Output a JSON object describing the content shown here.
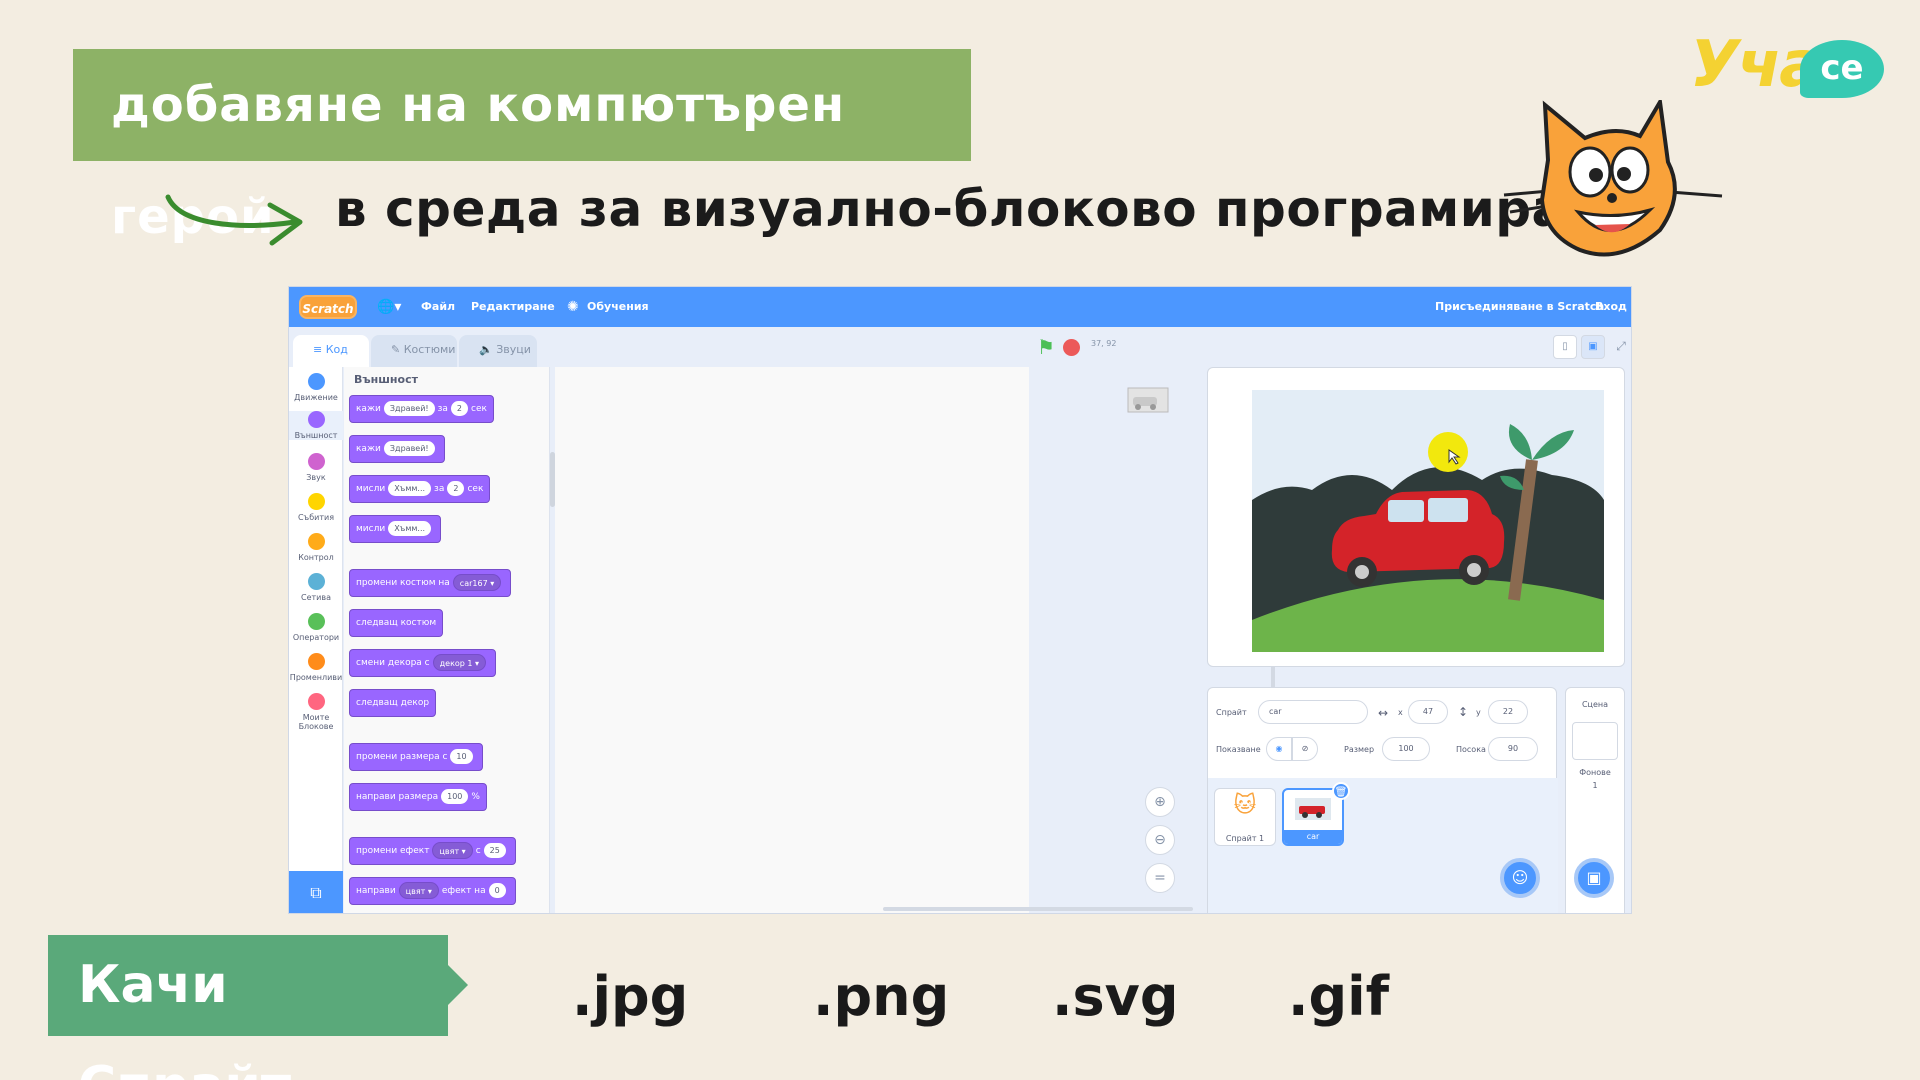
{
  "slide": {
    "title": "добавяне на компютърен герой",
    "subtitle": "в среда за визуално-блоково програмиране",
    "logo_text": "Уча",
    "logo_badge": "се",
    "upload_label": "Качи Спрайт",
    "extensions": [
      ".jpg",
      ".png",
      ".svg",
      ".gif"
    ]
  },
  "scratch": {
    "logo": "Scratch",
    "menu": {
      "file": "Файл",
      "edit": "Редактиране",
      "tutorials": "Обучения",
      "join": "Присъединяване в Scratch",
      "signin": "Вход"
    },
    "tabs": [
      "Код",
      "Костюми",
      "Звуци"
    ],
    "categories": [
      {
        "label": "Движение",
        "color": "#4c97ff"
      },
      {
        "label": "Външност",
        "color": "#9966ff"
      },
      {
        "label": "Звук",
        "color": "#cf63cf"
      },
      {
        "label": "Събития",
        "color": "#ffd500"
      },
      {
        "label": "Контрол",
        "color": "#ffab19"
      },
      {
        "label": "Сетива",
        "color": "#5cb1d6"
      },
      {
        "label": "Оператори",
        "color": "#59c059"
      },
      {
        "label": "Променливи",
        "color": "#ff8c1a"
      },
      {
        "label": "Моите Блокове",
        "color": "#ff6680"
      }
    ],
    "palette_title": "Външност",
    "blocks": {
      "say_for": {
        "verb": "кажи",
        "text": "Здравей!",
        "for": "за",
        "secs": "2",
        "unit": "сек"
      },
      "say": {
        "verb": "кажи",
        "text": "Здравей!"
      },
      "think_for": {
        "verb": "мисли",
        "text": "Хъмм...",
        "for": "за",
        "secs": "2",
        "unit": "сек"
      },
      "think": {
        "verb": "мисли",
        "text": "Хъмм..."
      },
      "switch_costume": {
        "text": "промени костюм на",
        "value": "car167 ▾"
      },
      "next_costume": {
        "text": "следващ костюм"
      },
      "switch_backdrop": {
        "text": "смени декора с",
        "value": "декор 1 ▾"
      },
      "next_backdrop": {
        "text": "следващ декор"
      },
      "change_size": {
        "text": "промени размера с",
        "value": "10"
      },
      "set_size": {
        "text": "направи размера",
        "value": "100",
        "unit": "%"
      },
      "change_effect": {
        "text": "промени ефект",
        "effect": "цвят ▾",
        "by": "с",
        "value": "25"
      },
      "set_effect": {
        "text": "направи",
        "effect": "цвят ▾",
        "to": "ефект на",
        "value": "0"
      }
    },
    "coords_readout": "37, 92",
    "sprite_info": {
      "sprite_label": "Спрайт",
      "sprite_name": "car",
      "x_label": "x",
      "x": "47",
      "y_label": "y",
      "y": "22",
      "show_label": "Показване",
      "size_label": "Размер",
      "size": "100",
      "direction_label": "Посока",
      "direction": "90"
    },
    "sprites": [
      {
        "name": "Спрайт 1"
      },
      {
        "name": "car"
      }
    ],
    "stage_panel": {
      "title": "Сцена",
      "backdrops_label": "Фонове",
      "backdrops_count": "1"
    }
  }
}
